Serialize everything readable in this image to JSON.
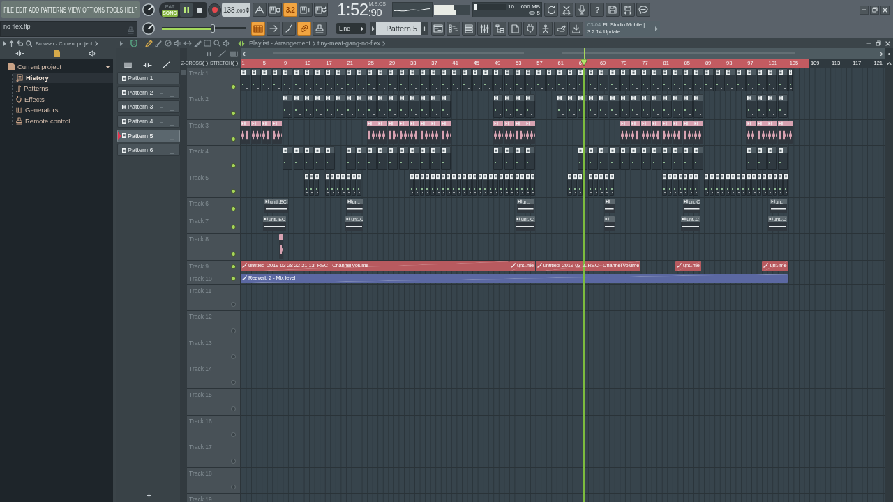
{
  "menu": [
    "FILE",
    "EDIT",
    "ADD",
    "PATTERNS",
    "VIEW",
    "OPTIONS",
    "TOOLS",
    "HELP"
  ],
  "hint_bar": {
    "text": "no flex.flp"
  },
  "transport": {
    "modes": [
      {
        "label": "PAT",
        "selected": false
      },
      {
        "label": "SONG",
        "selected": true
      }
    ],
    "playing": true,
    "tempo": {
      "whole": "138",
      "fraction": ".000"
    }
  },
  "toolbar_top": [
    {
      "on": false
    },
    {
      "on": false
    },
    {
      "on": true,
      "label": "3.2"
    },
    {
      "on": false
    },
    {
      "on": false
    }
  ],
  "time": {
    "format": "M:S:CS",
    "main": "1:52",
    "fraction": ":90"
  },
  "peak_meter": [
    {
      "level": 0.55
    },
    {
      "level": 0.6
    }
  ],
  "performance": {
    "cpu": {
      "level": 0.08,
      "reading": "10"
    },
    "memory": "656 MB",
    "polyphony": "5"
  },
  "toolbar_right": [
    {
      "on": false
    },
    {
      "on": false
    },
    {
      "on": false
    },
    {
      "on": false,
      "label": "?"
    },
    {
      "on": false
    },
    {
      "on": false
    },
    {
      "on": false
    }
  ],
  "master_volume": {
    "level": 0.61
  },
  "toolbar_bottom": [
    {
      "on": true
    },
    {
      "on": false
    },
    {
      "on": false
    },
    {
      "on": true
    },
    {
      "on": false
    }
  ],
  "snap": {
    "value": "Line"
  },
  "pattern_selector": {
    "value": "Pattern 5"
  },
  "view_buttons": [
    {
      "on": false
    },
    {
      "on": false
    },
    {
      "on": false
    },
    {
      "on": false
    },
    {
      "on": false
    },
    {
      "on": false
    },
    {
      "on": false
    },
    {
      "on": false
    },
    {
      "on": false
    },
    {
      "on": false
    }
  ],
  "news": {
    "date": "03-04",
    "lines": [
      "FL Studio Mobile |",
      "3.2.14 Update"
    ]
  },
  "browser": {
    "title": "Browser - Current project",
    "tree": [
      {
        "label": "Current project",
        "selected": false,
        "expanded": true,
        "children": [
          {
            "label": "History",
            "selected": true
          },
          {
            "label": "Patterns",
            "selected": false
          },
          {
            "label": "Effects",
            "selected": false
          },
          {
            "label": "Generators",
            "selected": false
          },
          {
            "label": "Remote control",
            "selected": false
          }
        ]
      }
    ]
  },
  "playlist": {
    "title": "Playlist - Arrangement",
    "arrangement": "tiny-meat-gang-no-flex",
    "patterns": [
      {
        "label": "Pattern 1",
        "selected": false
      },
      {
        "label": "Pattern 2",
        "selected": false
      },
      {
        "label": "Pattern 3",
        "selected": false
      },
      {
        "label": "Pattern 4",
        "selected": false
      },
      {
        "label": "Pattern 5",
        "selected": true
      },
      {
        "label": "Pattern 6",
        "selected": false
      }
    ],
    "options": [
      {
        "label": "Z-CROSS",
        "checked": false
      },
      {
        "label": "STRETCH",
        "checked": false
      }
    ],
    "ruler": [
      "1",
      "5",
      "9",
      "13",
      "17",
      "21",
      "25",
      "29",
      "33",
      "37",
      "41",
      "45",
      "49",
      "53",
      "57",
      "61",
      "6",
      "69",
      "73",
      "77",
      "81",
      "85",
      "89",
      "93",
      "97",
      "101",
      "105",
      "109",
      "113",
      "117",
      "121"
    ],
    "song_region": {
      "level": 0.883
    },
    "playhead": {
      "level": 0.533
    },
    "tracks": [
      {
        "name": "Track 1",
        "active": true,
        "clips": [
          {
            "kind": "pattern"
          },
          {
            "kind": "pattern"
          },
          {
            "kind": "pattern"
          },
          {
            "kind": "pattern"
          },
          {
            "kind": "pattern"
          },
          {
            "kind": "pattern"
          },
          {
            "kind": "pattern"
          },
          {
            "kind": "pattern"
          },
          {
            "kind": "pattern"
          },
          {
            "kind": "pattern"
          },
          {
            "kind": "pattern"
          },
          {
            "kind": "pattern"
          },
          {
            "kind": "pattern"
          },
          {
            "kind": "pattern"
          },
          {
            "kind": "pattern"
          },
          {
            "kind": "pattern"
          },
          {
            "kind": "pattern"
          },
          {
            "kind": "pattern"
          },
          {
            "kind": "pattern"
          },
          {
            "kind": "pattern"
          },
          {
            "kind": "pattern"
          },
          {
            "kind": "pattern"
          },
          {
            "kind": "pattern"
          },
          {
            "kind": "pattern"
          },
          {
            "kind": "pattern"
          },
          {
            "kind": "pattern"
          },
          {
            "kind": "pattern"
          },
          {
            "kind": "pattern"
          },
          {
            "kind": "pattern"
          },
          {
            "kind": "pattern"
          },
          {
            "kind": "pattern"
          },
          {
            "kind": "pattern"
          },
          {
            "kind": "pattern"
          },
          {
            "kind": "pattern"
          },
          {
            "kind": "pattern"
          },
          {
            "kind": "pattern"
          },
          {
            "kind": "pattern"
          },
          {
            "kind": "pattern"
          },
          {
            "kind": "pattern"
          },
          {
            "kind": "pattern"
          },
          {
            "kind": "pattern"
          },
          {
            "kind": "pattern"
          },
          {
            "kind": "pattern"
          },
          {
            "kind": "pattern"
          },
          {
            "kind": "pattern"
          },
          {
            "kind": "pattern"
          },
          {
            "kind": "pattern"
          },
          {
            "kind": "pattern"
          },
          {
            "kind": "pattern"
          },
          {
            "kind": "pattern"
          },
          {
            "kind": "pattern"
          },
          {
            "kind": "pattern"
          },
          {
            "kind": "pattern"
          }
        ]
      },
      {
        "name": "Track 2",
        "active": true,
        "clips": [
          {
            "kind": "pattern"
          },
          {
            "kind": "pattern"
          },
          {
            "kind": "pattern"
          },
          {
            "kind": "pattern"
          },
          {
            "kind": "pattern"
          },
          {
            "kind": "pattern"
          },
          {
            "kind": "pattern"
          },
          {
            "kind": "pattern"
          },
          {
            "kind": "pattern"
          },
          {
            "kind": "pattern"
          },
          {
            "kind": "pattern"
          },
          {
            "kind": "pattern"
          },
          {
            "kind": "pattern"
          },
          {
            "kind": "pattern"
          },
          {
            "kind": "pattern"
          },
          {
            "kind": "pattern"
          },
          {
            "kind": "pattern"
          },
          {
            "kind": "pattern"
          },
          {
            "kind": "pattern"
          },
          {
            "kind": "pattern"
          },
          {
            "kind": "pattern"
          },
          {
            "kind": "pattern"
          },
          {
            "kind": "pattern"
          },
          {
            "kind": "pattern"
          },
          {
            "kind": "pattern"
          },
          {
            "kind": "pattern"
          },
          {
            "kind": "pattern"
          },
          {
            "kind": "pattern"
          },
          {
            "kind": "pattern"
          },
          {
            "kind": "pattern"
          },
          {
            "kind": "pattern"
          },
          {
            "kind": "pattern"
          },
          {
            "kind": "pattern"
          },
          {
            "kind": "pattern"
          },
          {
            "kind": "pattern"
          },
          {
            "kind": "pattern"
          },
          {
            "kind": "pattern"
          },
          {
            "kind": "pattern"
          }
        ]
      },
      {
        "name": "Track 3",
        "active": true,
        "clips": [
          {
            "kind": "audio",
            "color": "#d7a2b1"
          },
          {
            "kind": "audio",
            "color": "#d7a2b1"
          },
          {
            "kind": "audio",
            "color": "#d7a2b1"
          },
          {
            "kind": "audio",
            "color": "#d7a2b1"
          },
          {
            "kind": "audio",
            "color": "#d7a2b1"
          },
          {
            "kind": "audio",
            "color": "#d7a2b1"
          },
          {
            "kind": "audio",
            "color": "#d7a2b1"
          },
          {
            "kind": "audio",
            "color": "#d7a2b1"
          },
          {
            "kind": "audio",
            "color": "#d7a2b1"
          },
          {
            "kind": "audio",
            "color": "#d7a2b1"
          },
          {
            "kind": "audio",
            "color": "#d7a2b1"
          },
          {
            "kind": "audio",
            "color": "#d7a2b1"
          },
          {
            "kind": "audio",
            "color": "#d7a2b1"
          },
          {
            "kind": "audio",
            "color": "#d7a2b1"
          },
          {
            "kind": "audio",
            "color": "#d7a2b1"
          },
          {
            "kind": "audio",
            "color": "#d7a2b1"
          },
          {
            "kind": "audio",
            "color": "#d7a2b1"
          },
          {
            "kind": "audio",
            "color": "#d7a2b1"
          },
          {
            "kind": "audio",
            "color": "#d7a2b1"
          },
          {
            "kind": "audio",
            "color": "#d7a2b1"
          },
          {
            "kind": "audio",
            "color": "#d7a2b1"
          },
          {
            "kind": "audio",
            "color": "#d7a2b1"
          },
          {
            "kind": "audio",
            "color": "#d7a2b1"
          },
          {
            "kind": "audio",
            "color": "#d7a2b1"
          },
          {
            "kind": "audio",
            "color": "#d7a2b1"
          },
          {
            "kind": "audio",
            "color": "#d7a2b1"
          },
          {
            "kind": "audio",
            "color": "#d7a2b1"
          },
          {
            "kind": "audio",
            "color": "#d7a2b1"
          },
          {
            "kind": "audio",
            "color": "#d7a2b1"
          }
        ]
      },
      {
        "name": "Track 4",
        "active": true,
        "clips": [
          {
            "kind": "pattern"
          },
          {
            "kind": "pattern"
          },
          {
            "kind": "pattern"
          },
          {
            "kind": "pattern"
          },
          {
            "kind": "pattern"
          },
          {
            "kind": "pattern"
          },
          {
            "kind": "pattern"
          },
          {
            "kind": "pattern"
          },
          {
            "kind": "pattern"
          },
          {
            "kind": "pattern"
          },
          {
            "kind": "pattern"
          },
          {
            "kind": "pattern"
          },
          {
            "kind": "pattern"
          },
          {
            "kind": "pattern"
          },
          {
            "kind": "pattern"
          },
          {
            "kind": "pattern"
          },
          {
            "kind": "pattern"
          },
          {
            "kind": "pattern"
          },
          {
            "kind": "pattern"
          },
          {
            "kind": "pattern"
          },
          {
            "kind": "pattern"
          },
          {
            "kind": "pattern"
          },
          {
            "kind": "pattern"
          },
          {
            "kind": "pattern"
          },
          {
            "kind": "pattern"
          },
          {
            "kind": "pattern"
          },
          {
            "kind": "pattern"
          },
          {
            "kind": "pattern"
          },
          {
            "kind": "pattern"
          },
          {
            "kind": "pattern"
          },
          {
            "kind": "pattern"
          },
          {
            "kind": "pattern"
          },
          {
            "kind": "pattern"
          },
          {
            "kind": "pattern"
          },
          {
            "kind": "pattern"
          }
        ]
      },
      {
        "name": "Track 5",
        "active": true,
        "clips": [
          {
            "kind": "pattern"
          },
          {
            "kind": "pattern"
          },
          {
            "kind": "pattern"
          },
          {
            "kind": "pattern"
          },
          {
            "kind": "pattern"
          },
          {
            "kind": "pattern"
          },
          {
            "kind": "pattern"
          },
          {
            "kind": "pattern"
          },
          {
            "kind": "pattern"
          },
          {
            "kind": "pattern"
          },
          {
            "kind": "pattern"
          },
          {
            "kind": "pattern"
          },
          {
            "kind": "pattern"
          },
          {
            "kind": "pattern"
          },
          {
            "kind": "pattern"
          },
          {
            "kind": "pattern"
          },
          {
            "kind": "pattern"
          },
          {
            "kind": "pattern"
          },
          {
            "kind": "pattern"
          },
          {
            "kind": "pattern"
          },
          {
            "kind": "pattern"
          },
          {
            "kind": "pattern"
          },
          {
            "kind": "pattern"
          },
          {
            "kind": "pattern"
          },
          {
            "kind": "pattern"
          },
          {
            "kind": "pattern"
          },
          {
            "kind": "pattern"
          },
          {
            "kind": "pattern"
          },
          {
            "kind": "pattern"
          },
          {
            "kind": "pattern"
          },
          {
            "kind": "pattern"
          },
          {
            "kind": "pattern"
          },
          {
            "kind": "pattern"
          },
          {
            "kind": "pattern"
          },
          {
            "kind": "pattern"
          },
          {
            "kind": "pattern"
          },
          {
            "kind": "pattern"
          },
          {
            "kind": "pattern"
          },
          {
            "kind": "pattern"
          },
          {
            "kind": "pattern"
          },
          {
            "kind": "pattern"
          },
          {
            "kind": "pattern"
          },
          {
            "kind": "pattern"
          },
          {
            "kind": "pattern"
          },
          {
            "kind": "pattern"
          },
          {
            "kind": "pattern"
          },
          {
            "kind": "pattern"
          },
          {
            "kind": "pattern"
          },
          {
            "kind": "pattern"
          },
          {
            "kind": "pattern"
          },
          {
            "kind": "pattern"
          },
          {
            "kind": "pattern"
          },
          {
            "kind": "pattern"
          },
          {
            "kind": "pattern"
          },
          {
            "kind": "pattern"
          },
          {
            "kind": "pattern"
          },
          {
            "kind": "pattern"
          },
          {
            "kind": "pattern"
          },
          {
            "kind": "pattern"
          },
          {
            "kind": "pattern"
          },
          {
            "kind": "pattern"
          },
          {
            "kind": "pattern"
          },
          {
            "kind": "pattern"
          },
          {
            "kind": "pattern"
          },
          {
            "kind": "pattern"
          }
        ]
      },
      {
        "name": "Track 6",
        "active": true,
        "clips": [
          {
            "kind": "audio",
            "color": "#5d686e",
            "label": "unti..EC"
          },
          {
            "kind": "audio",
            "color": "#5d686e",
            "label": "un.."
          },
          {
            "kind": "audio",
            "color": "#5d686e",
            "label": "un.."
          },
          {
            "kind": "audio",
            "color": "#5d686e"
          },
          {
            "kind": "audio",
            "color": "#5d686e",
            "label": "un..C"
          },
          {
            "kind": "audio",
            "color": "#5d686e",
            "label": "un.."
          }
        ]
      },
      {
        "name": "Track 7",
        "active": true,
        "clips": [
          {
            "kind": "audio",
            "color": "#5d686e",
            "label": "unti..EC"
          },
          {
            "kind": "audio",
            "color": "#5d686e",
            "label": "unt..C"
          },
          {
            "kind": "audio",
            "color": "#5d686e",
            "label": "unt..C"
          },
          {
            "kind": "audio",
            "color": "#5d686e"
          },
          {
            "kind": "audio",
            "color": "#5d686e",
            "label": "unt..C"
          },
          {
            "kind": "audio",
            "color": "#5d686e",
            "label": "unt..C"
          }
        ]
      },
      {
        "name": "Track 8",
        "active": true,
        "clips": [
          {
            "kind": "audio",
            "color": "#d7a2b1"
          }
        ]
      },
      {
        "name": "Track 9",
        "active": true,
        "clips": [
          {
            "kind": "automation",
            "color": "#b85a5f",
            "label": "untitled_2019-03-28 22-21-13_REC - Channel volume"
          },
          {
            "kind": "automation",
            "color": "#b85a5f",
            "label": "unt..me"
          },
          {
            "kind": "automation",
            "color": "#b85a5f",
            "label": "untitled_2019-03-2..REC - Channel volume"
          },
          {
            "kind": "automation",
            "color": "#b85a5f",
            "label": "unt..me"
          },
          {
            "kind": "automation",
            "color": "#b85a5f",
            "label": "unt..me"
          }
        ]
      },
      {
        "name": "Track 10",
        "active": true,
        "clips": [
          {
            "kind": "automation",
            "color": "#5b68a2",
            "label": "Reeverb 2 - Mix level"
          }
        ]
      },
      {
        "name": "Track 11",
        "active": false
      },
      {
        "name": "Track 12",
        "active": false
      },
      {
        "name": "Track 13",
        "active": false
      },
      {
        "name": "Track 14",
        "active": false
      },
      {
        "name": "Track 15",
        "active": false
      },
      {
        "name": "Track 16",
        "active": false
      },
      {
        "name": "Track 17",
        "active": false
      },
      {
        "name": "Track 18",
        "active": false
      },
      {
        "name": "Track 19"
      }
    ]
  }
}
